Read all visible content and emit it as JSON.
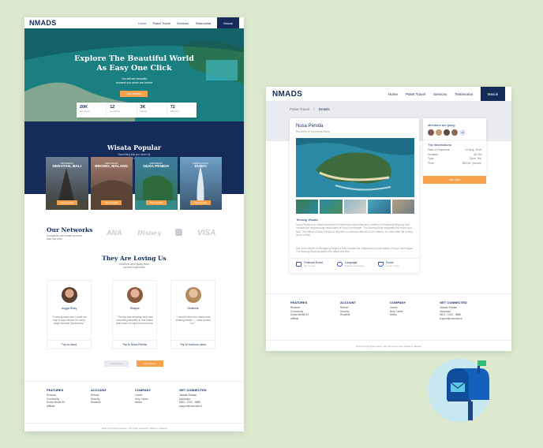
{
  "landing": {
    "logo": "NMADS",
    "nav": [
      "Home",
      "Paket Travel",
      "Services",
      "Testimonial"
    ],
    "login_label": "Masuk",
    "hero": {
      "title_line1": "Explore The Beautiful World",
      "title_line2": "As Easy One Click",
      "subtitle_line1": "You will see beautiful",
      "subtitle_line2": "moment you never see before",
      "cta": "Get Started"
    },
    "stats": [
      {
        "value": "20K",
        "label": "Members"
      },
      {
        "value": "12",
        "label": "Countries"
      },
      {
        "value": "3K",
        "label": "Hotels"
      },
      {
        "value": "72",
        "label": "Partners"
      }
    ],
    "popular": {
      "title": "Wisata Popular",
      "subtitle_line1": "Something that you never try",
      "subtitle_line2": "before in this world"
    },
    "cards": [
      {
        "country": "INDONESIA",
        "place": "DERATAN, BALI",
        "button": "View Details"
      },
      {
        "country": "INDONESIA",
        "place": "BROMO, MALANG",
        "button": "View Details"
      },
      {
        "country": "INDONESIA",
        "place": "NUSA PENIDA",
        "button": "View Details"
      },
      {
        "country": "MIDDLE EAST",
        "place": "DUBAI",
        "button": "View Details"
      }
    ],
    "networks": {
      "title": "Our Networks",
      "subtitle": "Companies are trusted us more than just a trip",
      "brands": [
        "ANA",
        "Disney",
        "VISA"
      ]
    },
    "testimonials": {
      "title": "They Are Loving Us",
      "subtitle_line1": "Moments were giving them",
      "subtitle_line2": "the best experience",
      "items": [
        {
          "name": "Angga Risky",
          "quote": "“ It was glorious and I could not stop to say wohooo for every single moment Dankeeeee ”",
          "trip": "Trip to Ubud"
        },
        {
          "name": "Shayna",
          "quote": "“ The trip was amazing and I saw something beautiful in that Island that make me want to learn more ”",
          "trip": "Trip to Nusa Penida"
        },
        {
          "name": "Shabrina",
          "quote": "“ I loved it when the waves was shaking harder — I was scared too ”",
          "trip": "Trip to Karimun Jawa"
        }
      ],
      "help_label": "I Need Help",
      "next_label": "Get Started"
    },
    "footer": {
      "features": {
        "title": "FEATURES",
        "items": [
          "Reviews",
          "Community",
          "Social Media Kit",
          "Affiliate"
        ]
      },
      "account": {
        "title": "ACCOUNT",
        "items": [
          "Refund",
          "Security",
          "Rewards"
        ]
      },
      "company": {
        "title": "COMPANY",
        "items": [
          "Career",
          "Help Center",
          "Media"
        ]
      },
      "connected": {
        "title": "GET CONNECTED",
        "items": [
          "Jakarta Selatan",
          "Indonesia",
          "0821 - 2222 - 8888",
          "support@nomads.id"
        ]
      },
      "copyright": "2019 Copyright Nomads • All rights reserved • Made in Jakarta"
    }
  },
  "detail": {
    "logo": "NMADS",
    "nav": [
      "Home",
      "Paket Travel",
      "Services",
      "Testimonial"
    ],
    "login_label": "Masuk",
    "breadcrumb": [
      "Paket Travel",
      "Details"
    ],
    "title": "Nusa Penida",
    "location": "Republic of Indonesia Raya",
    "about_title": "Tentang Wisata",
    "about_text_1": "Nusa Penida is an island southeast of Indonesia's island Bali and a district of Klungkung Regency that includes the neighbouring small island of Nusa Lembongan. The Badung Strait separates the island and Bali. The interior of Nusa Penida is hilly with a maximum altitude of 524 metres. It is drier than the nearby island of Bali.",
    "about_text_2": "Bali and a district of Klungkung Regency that includes the neighbouring small island of Nusa Lembongan. The Badung Strait separates the island and Bali.",
    "features": [
      {
        "title": "Featured Event",
        "sub": "Tari Kecak"
      },
      {
        "title": "Language",
        "sub": "Bahasa Indonesia"
      },
      {
        "title": "Foods",
        "sub": "Local Foods"
      }
    ],
    "members_title": "Members are going",
    "members_extra": "+2",
    "trip_info_title": "Trip Informations",
    "trip_info": [
      {
        "label": "Date of Departure",
        "value": "22 Aug, 2019"
      },
      {
        "label": "Duration",
        "value": "4D 3N"
      },
      {
        "label": "Type",
        "value": "Open Trip"
      },
      {
        "label": "Price",
        "value": "$80,00 / person"
      }
    ],
    "book_label": "Join Now",
    "footer": {
      "features": {
        "title": "FEATURES",
        "items": [
          "Reviews",
          "Community",
          "Social Media Kit",
          "Affiliate"
        ]
      },
      "account": {
        "title": "ACCOUNT",
        "items": [
          "Refund",
          "Security",
          "Rewards"
        ]
      },
      "company": {
        "title": "COMPANY",
        "items": [
          "Career",
          "Help Center",
          "Media"
        ]
      },
      "connected": {
        "title": "GET CONNECTED",
        "items": [
          "Jakarta Selatan",
          "Indonesia",
          "0821 - 2222 - 8888",
          "support@nomads.id"
        ]
      },
      "copyright": "2019 Copyright Nomads • All rights reserved • Made in Jakarta"
    }
  },
  "colors": {
    "navy": "#152c5b",
    "orange": "#f8a14a",
    "blue": "#3252df",
    "background": "#dde9cf"
  }
}
